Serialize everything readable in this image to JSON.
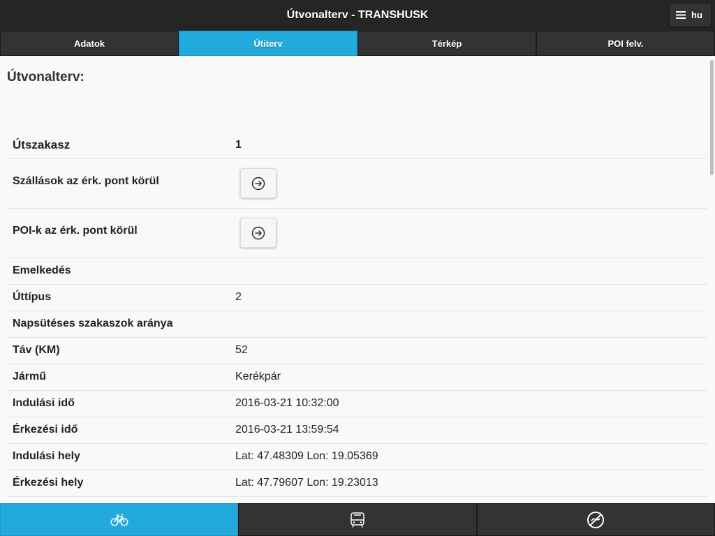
{
  "header": {
    "title": "Útvonalterv - TRANSHUSK",
    "lang_label": "hu",
    "menu_icon": "hamburger-icon"
  },
  "tabs": [
    {
      "label": "Adatok",
      "active": false
    },
    {
      "label": "Útiterv",
      "active": true
    },
    {
      "label": "Térkép",
      "active": false
    },
    {
      "label": "POI felv.",
      "active": false
    }
  ],
  "page": {
    "heading": "Útvonalterv:"
  },
  "details": {
    "segment_label": "Útszakasz",
    "segment_value": "1",
    "accommodations_label": "Szállások az érk. pont körül",
    "pois_label": "POI-k az érk. pont körül",
    "elevation_label": "Emelkedés",
    "elevation_value": "",
    "road_type_label": "Úttípus",
    "road_type_value": "2",
    "sunny_ratio_label": "Napsütéses szakaszok aránya",
    "sunny_ratio_value": "",
    "distance_label": "Táv (KM)",
    "distance_value": "52",
    "vehicle_label": "Jármű",
    "vehicle_value": "Kerékpár",
    "departure_time_label": "Indulási idő",
    "departure_time_value": "2016-03-21 10:32:00",
    "arrival_time_label": "Érkezési idő",
    "arrival_time_value": "2016-03-21 13:59:54",
    "departure_place_label": "Indulási hely",
    "departure_place_value": "Lat: 47.48309 Lon: 19.05369",
    "arrival_place_label": "Érkezési hely",
    "arrival_place_value": "Lat: 47.79607 Lon: 19.23013"
  },
  "bottom_nav": [
    {
      "icon": "bicycle-icon",
      "active": true
    },
    {
      "icon": "bus-icon",
      "active": false
    },
    {
      "icon": "no-walking-icon",
      "active": false
    }
  ],
  "colors": {
    "accent": "#22aadd",
    "bar": "#333333",
    "header": "#252525"
  }
}
